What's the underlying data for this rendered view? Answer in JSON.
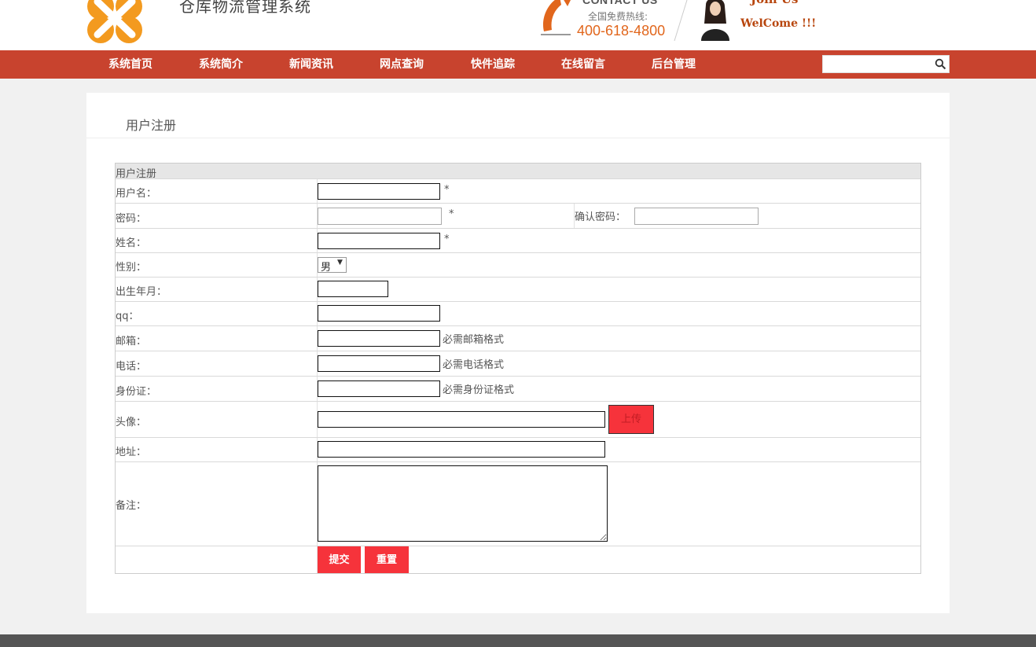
{
  "header": {
    "site_title": "仓库物流管理系统",
    "contact_en": "CONTACT US",
    "contact_cn": "全国免费热线:",
    "hotline": "400-618-4800",
    "join_us": "Join Us",
    "welcome": "WelCome !!!"
  },
  "nav": {
    "items": [
      {
        "label": "系统首页"
      },
      {
        "label": "系统简介"
      },
      {
        "label": "新闻资讯"
      },
      {
        "label": "网点查询"
      },
      {
        "label": "快件追踪"
      },
      {
        "label": "在线留言"
      },
      {
        "label": "后台管理"
      }
    ],
    "search_value": ""
  },
  "page": {
    "title": "用户注册"
  },
  "form": {
    "header": "用户注册",
    "username_label": "用户名：",
    "password_label": "密码：",
    "confirm_label": "确认密码：",
    "name_label": "姓名：",
    "gender_label": "性别：",
    "gender_value": "男",
    "birth_label": "出生年月：",
    "qq_label": "qq：",
    "email_label": "邮箱：",
    "email_hint": "必需邮箱格式",
    "phone_label": "电话：",
    "phone_hint": "必需电话格式",
    "idcard_label": "身份证：",
    "idcard_hint": "必需身份证格式",
    "avatar_label": "头像：",
    "upload_label": "上传",
    "address_label": "地址：",
    "remark_label": "备注：",
    "required_mark": "*",
    "submit_label": "提交",
    "reset_label": "重置"
  },
  "colors": {
    "nav_bg": "#c8432e",
    "button_red": "#f6333b",
    "hotline_orange": "#e1661c"
  }
}
